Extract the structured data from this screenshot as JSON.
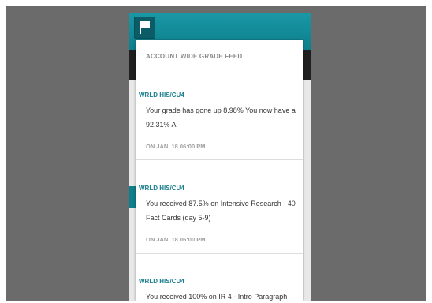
{
  "feed": {
    "header": "ACCOUNT WIDE GRADE FEED",
    "items": [
      {
        "course": "WRLD HIS/CU4",
        "message": "Your grade has gone up 8.98% You now have a 92.31% A-",
        "date": "ON JAN, 18 06:00 PM"
      },
      {
        "course": "WRLD HIS/CU4",
        "message": "You received 87.5% on Intensive Research - 40 Fact Cards (day 5-9)",
        "date": "ON JAN, 18 06:00 PM"
      },
      {
        "course": "WRLD HIS/CU4",
        "message": "You received 100% on IR 4 - Intro Paragraph",
        "date": ""
      }
    ]
  },
  "topbar": {
    "icon": "flag-icon"
  },
  "colors": {
    "accent": "#0e7f8c",
    "course_label": "#1a7f8e",
    "backdrop": "#6b6b6b"
  }
}
